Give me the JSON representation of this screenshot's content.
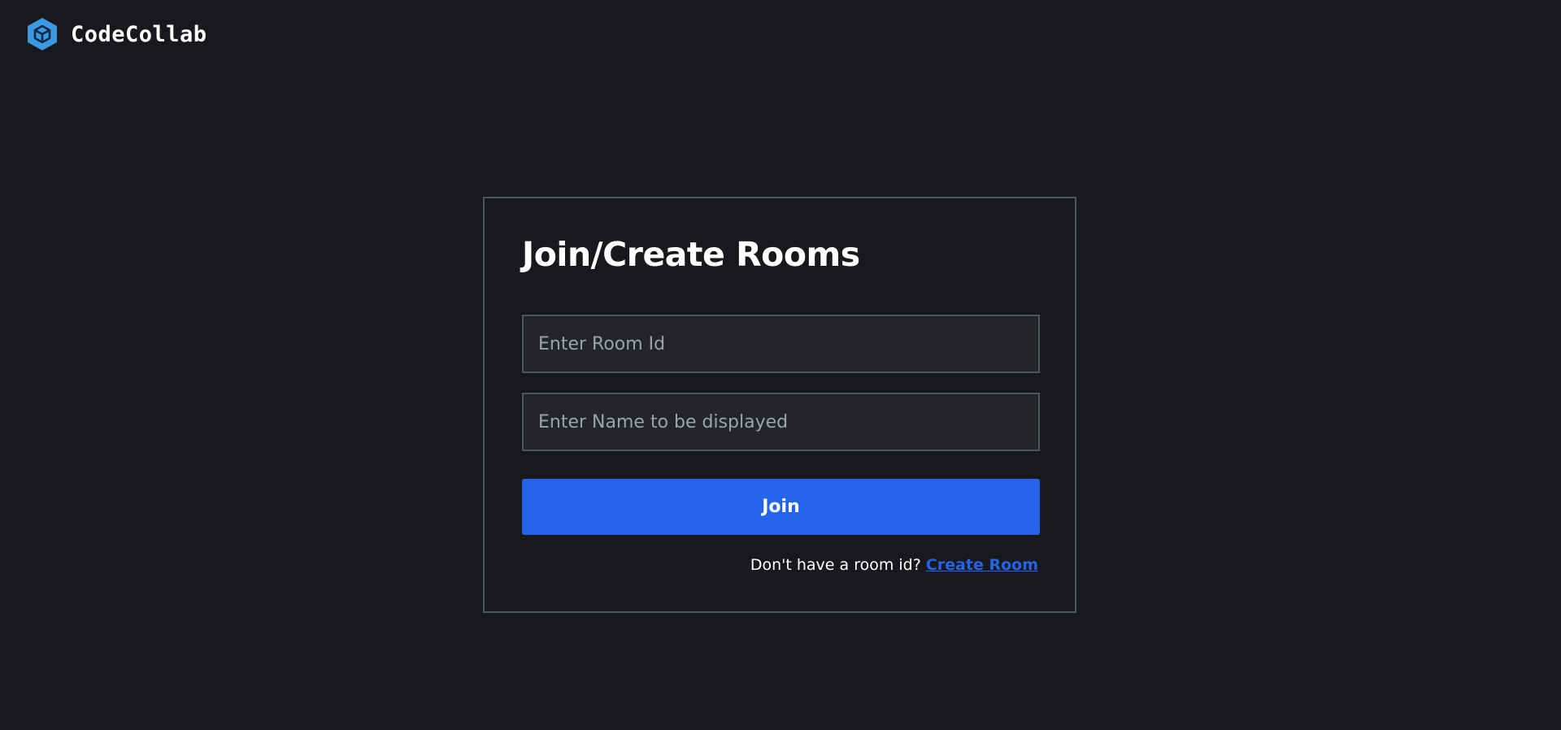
{
  "header": {
    "brand": "CodeCollab",
    "logo_icon": "cube-hexagon-icon",
    "logo_color": "#3b9ae1"
  },
  "card": {
    "title": "Join/Create Rooms",
    "room_id_input": {
      "placeholder": "Enter Room Id",
      "value": ""
    },
    "name_input": {
      "placeholder": "Enter Name to be displayed",
      "value": ""
    },
    "join_label": "Join",
    "footer_prompt": "Don't have a room id?",
    "create_link_label": "Create Room"
  },
  "colors": {
    "background": "#18191c",
    "accent": "#2563eb",
    "border": "#4b5563"
  }
}
